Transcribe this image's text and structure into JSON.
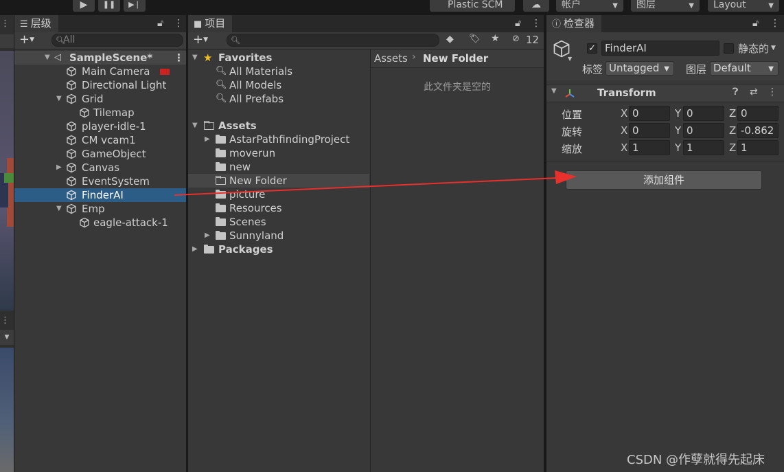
{
  "toolbar": {
    "play_icon": "▶",
    "pause_icon": "❚❚",
    "step_icon": "▶❘",
    "plastic_label": "Plastic SCM",
    "cloud_icon": "☁",
    "account_label": "帐户",
    "layers_label": "图层",
    "layout_label": "Layout"
  },
  "hierarchy": {
    "tab_title": "层级",
    "search_placeholder": "All",
    "scene_name": "SampleScene*",
    "items": [
      {
        "label": "Main Camera"
      },
      {
        "label": "Directional Light"
      },
      {
        "label": "Grid"
      },
      {
        "label": "Tilemap"
      },
      {
        "label": "player-idle-1"
      },
      {
        "label": "CM vcam1"
      },
      {
        "label": "GameObject"
      },
      {
        "label": "Canvas"
      },
      {
        "label": "EventSystem"
      },
      {
        "label": "FinderAI"
      },
      {
        "label": "Emp"
      },
      {
        "label": "eagle-attack-1"
      }
    ]
  },
  "project": {
    "tab_title": "项目",
    "hidden_count": "12",
    "favorites_label": "Favorites",
    "favorites": [
      "All Materials",
      "All Models",
      "All Prefabs"
    ],
    "assets_label": "Assets",
    "assets_children": [
      "AstarPathfindingProject",
      "moverun",
      "new",
      "New Folder",
      "picture",
      "Resources",
      "Scenes",
      "Sunnyland"
    ],
    "packages_label": "Packages",
    "breadcrumb_root": "Assets",
    "breadcrumb_current": "New Folder",
    "empty_message": "此文件夹是空的"
  },
  "inspector": {
    "tab_title": "检查器",
    "object_name": "FinderAI",
    "static_label": "静态的",
    "tag_label": "标签",
    "tag_value": "Untagged",
    "layer_label": "图层",
    "layer_value": "Default",
    "component_title": "Transform",
    "position_label": "位置",
    "rotation_label": "旋转",
    "scale_label": "缩放",
    "axis_x": "X",
    "axis_y": "Y",
    "axis_z": "Z",
    "position": {
      "x": "0",
      "y": "0",
      "z": "0"
    },
    "rotation": {
      "x": "0",
      "y": "0",
      "z": "-0.862"
    },
    "scale": {
      "x": "1",
      "y": "1",
      "z": "1"
    },
    "add_component_label": "添加组件"
  },
  "watermark": "CSDN @作孽就得先起床",
  "colors": {
    "selection": "#2c5d87",
    "annotation_arrow": "#e8302c",
    "panel_bg": "#383838"
  }
}
